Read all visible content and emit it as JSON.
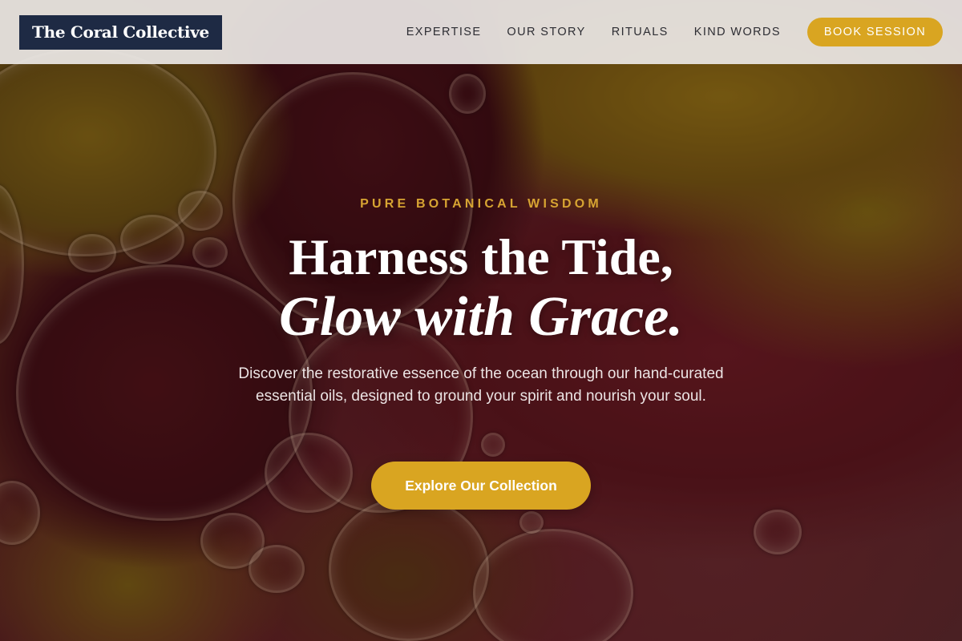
{
  "brand": {
    "name": "The Coral Collective",
    "logo_bg": "#1e2a44"
  },
  "nav": {
    "links": [
      {
        "label": "EXPERTISE"
      },
      {
        "label": "OUR STORY"
      },
      {
        "label": "RITUALS"
      },
      {
        "label": "KIND WORDS"
      }
    ],
    "book_label": "BOOK SESSION"
  },
  "hero": {
    "eyebrow": "PURE BOTANICAL WISDOM",
    "headline_line1": "Harness the Tide,",
    "headline_line2": "Glow with Grace.",
    "subtitle": "Discover the restorative essence of the ocean through our hand-curated essential oils, designed to ground your spirit and nourish your soul.",
    "cta_label": "Explore Our Collection"
  },
  "colors": {
    "accent": "#d9a521",
    "eyebrow": "#d7a432",
    "header_bg": "#ece8e6"
  }
}
